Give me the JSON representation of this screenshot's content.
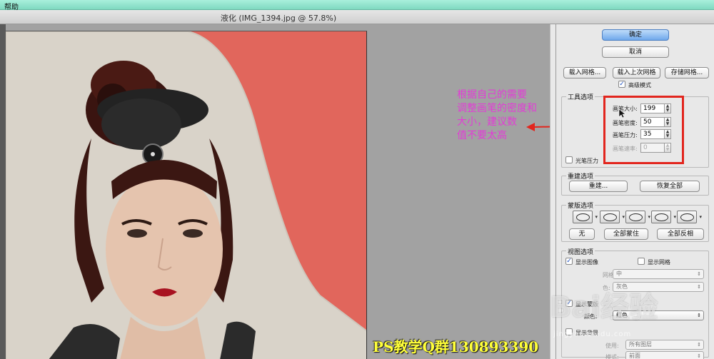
{
  "menubar": {
    "help": "帮助"
  },
  "window": {
    "title": "液化 (IMG_1394.jpg @ 57.8%)"
  },
  "buttons": {
    "ok": "确定",
    "cancel": "取消",
    "load_mesh": "载入网格...",
    "load_last_mesh": "载入上次网格",
    "save_mesh": "存储网格..."
  },
  "advanced_mode": {
    "label": "高级模式",
    "checked": true
  },
  "tool_options": {
    "title": "工具选项",
    "brush_size": {
      "label": "画笔大小:",
      "value": "199"
    },
    "brush_density": {
      "label": "画笔密度:",
      "value": "50"
    },
    "brush_pressure": {
      "label": "画笔压力:",
      "value": "35"
    },
    "brush_rate": {
      "label": "画笔速率:",
      "value": "0"
    },
    "stylus_pressure": "光笔压力"
  },
  "reconstruct_options": {
    "title": "重建选项",
    "reconstruct": "重建...",
    "restore_all": "恢复全部"
  },
  "mask_options": {
    "title": "蒙版选项",
    "none": "无",
    "mask_all": "全部蒙住",
    "invert_all": "全部反相"
  },
  "view_options": {
    "title": "视图选项",
    "show_image": "显示图像",
    "show_mesh": "显示网格",
    "mesh_size_label": "网格大小:",
    "mesh_size_value": "中",
    "mesh_color_label": "色:",
    "mesh_color_value": "灰色",
    "show_mask": "显示蒙版",
    "mask_color_label": "颜色:",
    "mask_color_value": "红色",
    "show_backdrop": "显示背景",
    "use_label": "使用:",
    "use_value": "所有图层",
    "mode_label": "模式:",
    "mode_value": "前面"
  },
  "annotation": {
    "lines": [
      "根据自己的需要",
      "调整画笔的密度和",
      "大小，建议数",
      "值不要太高"
    ]
  },
  "watermarks": {
    "qq": "PS教学Q群130893390",
    "baidu": "Bai经验",
    "url": "jingyan.baidu.com"
  },
  "colors": {
    "photo_bg": "#e1665c",
    "annotation": "#e33bd6",
    "highlight_box": "#e2261e",
    "qq_text": "#ffff3a"
  }
}
